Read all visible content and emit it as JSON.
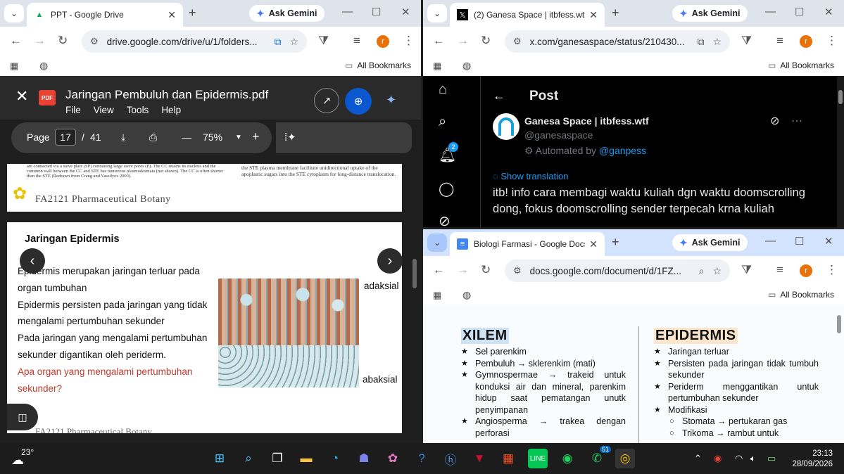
{
  "drive_window": {
    "tab_title": "PPT - Google Drive",
    "ask_gemini": "Ask Gemini",
    "url": "drive.google.com/drive/u/1/folders...",
    "avatar": "r",
    "all_bookmarks": "All Bookmarks",
    "pdf": {
      "badge": "PDF",
      "file_title": "Jaringan Pembuluh dan Epidermis.pdf",
      "menu": [
        "File",
        "View",
        "Tools",
        "Help"
      ],
      "page_label": "Page",
      "page_current": "17",
      "page_sep": "/",
      "page_total": "41",
      "zoom": "75%",
      "page_top": {
        "left_text": "are connected via a sieve plate (SP) containing large sieve pores (P). The CC retains its nucleus and the common wall between the CC and STE has numerous plasmodesmata (not shown). The CC is often shorter than the STE (Redrawn from Crang and Vassilyev 2003).",
        "right_text": "the STE plasma membrane facilitate unidirectional uptake of the apoplastic sugars into the STE cytoplasm for long-distance translocation.",
        "brand": "FA2121 Pharmaceutical Botany"
      },
      "slide": {
        "heading": "Jaringan Epidermis",
        "lines": [
          "Epidermis merupakan jaringan terluar pada organ tumbuhan",
          "Epidermis persisten pada jaringan yang tidak mengalami pertumbuhan sekunder",
          "Pada jaringan yang mengalami pertumbuhan sekunder digantikan oleh periderm."
        ],
        "question": "Apa organ yang mengalami pertumbuhan sekunder?",
        "label_top": "adaksial",
        "label_bottom": "abaksial",
        "brand": "FA2121 Pharmaceutical Botany"
      }
    }
  },
  "x_window": {
    "tab_title": "(2) Ganesa Space | itbfess.wtf on X",
    "ask_gemini": "Ask Gemini",
    "url": "x.com/ganesaspace/status/210430...",
    "avatar": "r",
    "all_bookmarks": "All Bookmarks",
    "notif_count": "2",
    "header": "Post",
    "author_name": "Ganesa Space | itbfess.wtf",
    "author_handle": "@ganesaspace",
    "automated_prefix": "Automated by",
    "automated_by": "@ganpess",
    "translate": "Show translation",
    "post_text": "itb! info cara membagi waktu kuliah dgn waktu doomscrolling dong, fokus doomscrolling sender terpecah krna kuliah"
  },
  "docs_window": {
    "tab_title": "Biologi Farmasi - Google Docs",
    "ask_gemini": "Ask Gemini",
    "url": "docs.google.com/document/d/1FZ...",
    "avatar": "r",
    "all_bookmarks": "All Bookmarks",
    "xilem": {
      "title": "XILEM",
      "items": [
        "Sel parenkim",
        "Pembuluh → sklerenkim (mati)",
        "Gymnospermae → trakeid untuk konduksi air dan mineral, parenkim hidup saat pematangan unutk penyimpanan",
        "Angiosperma → trakea dengan perforasi"
      ]
    },
    "epidermis": {
      "title": "EPIDERMIS",
      "items": [
        "Jaringan terluar",
        "Persisten pada jaringan tidak tumbuh sekunder",
        "Periderm menggantikan untuk pertumbuhan sekunder",
        "Modifikasi"
      ],
      "sub_items": [
        "Stomata → pertukaran gas",
        "Trikoma → rambut untuk"
      ]
    }
  },
  "taskbar": {
    "temperature": "23°",
    "whatsapp_badge": "51",
    "time": "23:13",
    "date": "28/09/2026"
  }
}
